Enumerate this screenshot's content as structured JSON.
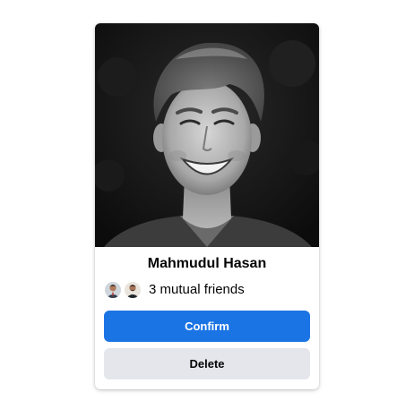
{
  "friend_request": {
    "name": "Mahmudul Hasan",
    "mutual_friends_text": "3 mutual friends",
    "confirm_label": "Confirm",
    "delete_label": "Delete"
  },
  "colors": {
    "confirm_bg": "#1b74e4",
    "delete_bg": "#e4e6eb",
    "text": "#050505"
  },
  "icons": {
    "profile_photo": "profile-photo",
    "mutual_avatar_1": "mutual-friend-avatar",
    "mutual_avatar_2": "mutual-friend-avatar"
  }
}
